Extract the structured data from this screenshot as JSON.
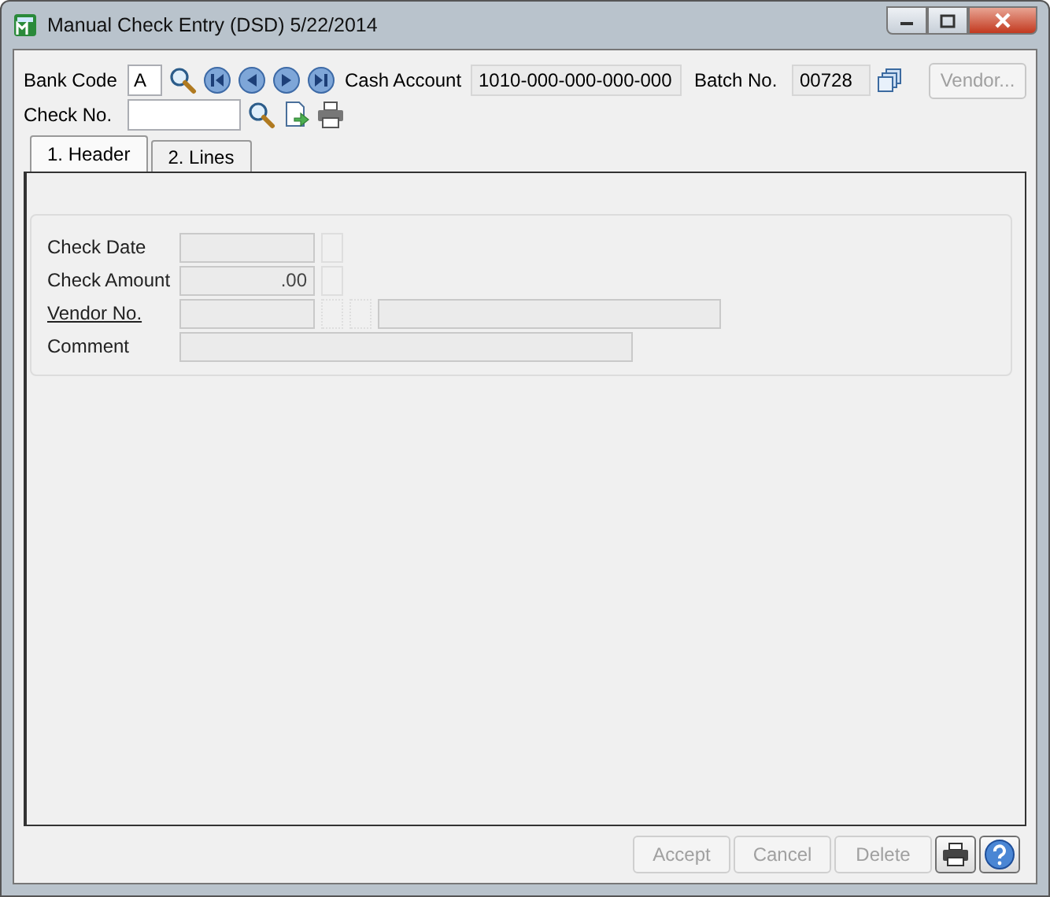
{
  "window": {
    "title": "Manual Check Entry (DSD) 5/22/2014"
  },
  "header": {
    "bank_code": {
      "label": "Bank Code",
      "value": "A"
    },
    "cash_account": {
      "label": "Cash Account",
      "value": "1010-000-000-000-000"
    },
    "batch_no": {
      "label": "Batch No.",
      "value": "00728"
    },
    "vendor_button": {
      "label": "Vendor...",
      "disabled": true
    },
    "check_no": {
      "label": "Check No."
    }
  },
  "tabs": [
    {
      "label": "1. Header",
      "selected": true
    },
    {
      "label": "2. Lines",
      "selected": false
    }
  ],
  "fields": [
    {
      "label": "Check Date",
      "kind": "date"
    },
    {
      "label": "Check Amount",
      "kind": "amount",
      "value": ".00"
    },
    {
      "label": "Vendor No.",
      "kind": "vendor"
    },
    {
      "label": "Comment",
      "kind": "comment"
    }
  ],
  "buttons": [
    {
      "label": "Accept",
      "disabled": true
    },
    {
      "label": "Cancel",
      "disabled": true
    },
    {
      "label": "Delete",
      "disabled": true
    }
  ]
}
